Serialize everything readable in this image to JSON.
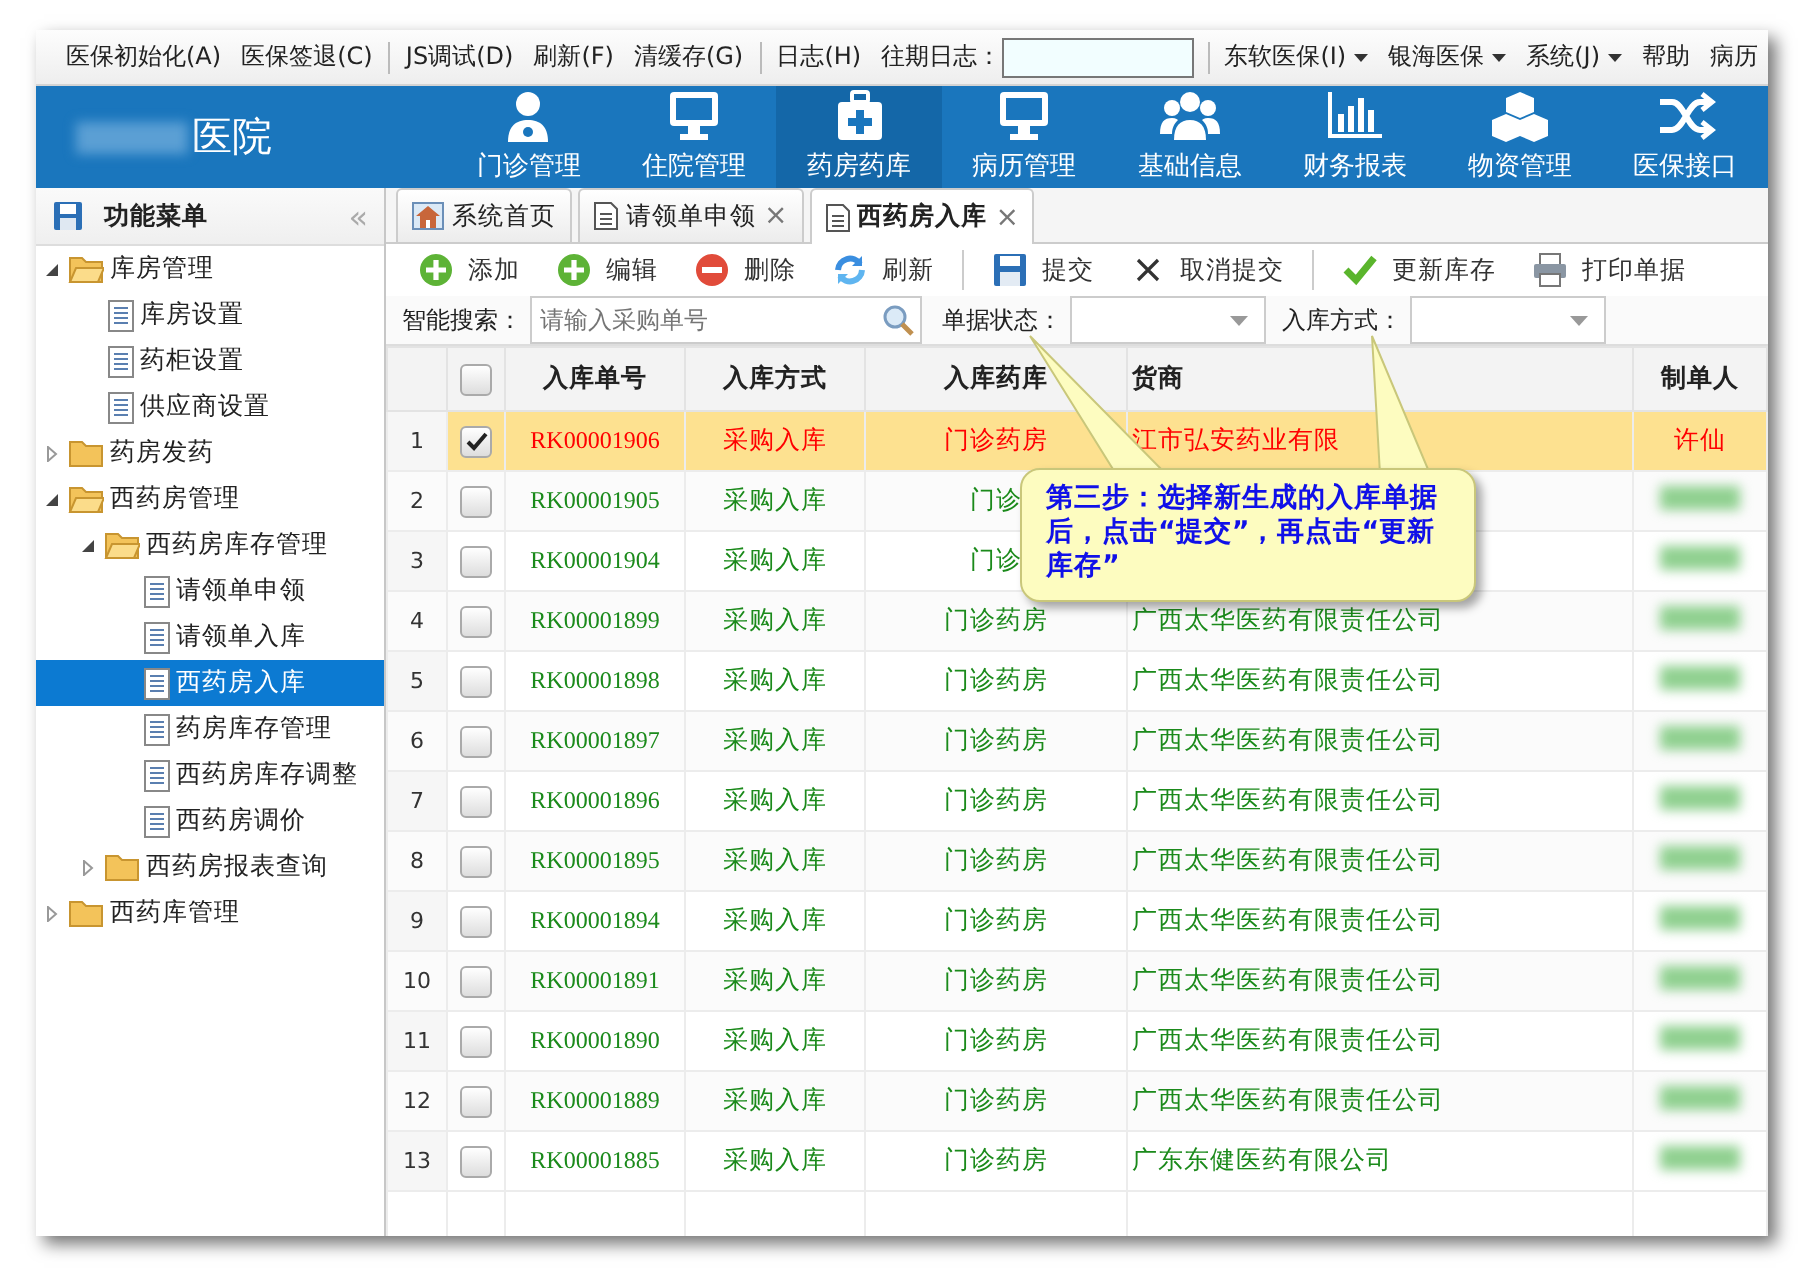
{
  "menu_bar": [
    {
      "kind": "item",
      "label": "医保初始化(A)",
      "has_menu": false
    },
    {
      "kind": "item",
      "label": "医保签退(C)",
      "has_menu": false
    },
    {
      "kind": "separator"
    },
    {
      "kind": "item",
      "label": "JS调试(D)",
      "has_menu": false
    },
    {
      "kind": "item",
      "label": "刷新(F)",
      "has_menu": false
    },
    {
      "kind": "item",
      "label": "清缓存(G)",
      "has_menu": false
    },
    {
      "kind": "separator"
    },
    {
      "kind": "item",
      "label": "日志(H)",
      "has_menu": false
    },
    {
      "kind": "field",
      "label": "往期日志："
    },
    {
      "kind": "separator"
    },
    {
      "kind": "item",
      "label": "东软医保(I)",
      "has_menu": true
    },
    {
      "kind": "item",
      "label": "银海医保",
      "has_menu": true
    },
    {
      "kind": "item",
      "label": "系统(J)",
      "has_menu": true
    },
    {
      "kind": "item",
      "label": "帮助",
      "has_menu": false
    },
    {
      "kind": "item",
      "label": "病历",
      "has_menu": false
    }
  ],
  "header": {
    "hospital": "医院",
    "nav": [
      {
        "label": "门诊管理",
        "selected": false
      },
      {
        "label": "住院管理",
        "selected": false
      },
      {
        "label": "药房药库",
        "selected": true
      },
      {
        "label": "病历管理",
        "selected": false
      },
      {
        "label": "基础信息",
        "selected": false
      },
      {
        "label": "财务报表",
        "selected": false
      },
      {
        "label": "物资管理",
        "selected": false
      },
      {
        "label": "医保接口",
        "selected": false
      }
    ]
  },
  "sidebar": {
    "title": "功能菜单",
    "collapse": "«",
    "tree": [
      {
        "kind": "folder",
        "label": "库房管理",
        "expanded": true,
        "children": [
          {
            "kind": "page",
            "label": "库房设置",
            "selected": false
          },
          {
            "kind": "page",
            "label": "药柜设置",
            "selected": false
          },
          {
            "kind": "page",
            "label": "供应商设置",
            "selected": false
          }
        ]
      },
      {
        "kind": "folder",
        "label": "药房发药",
        "expanded": false
      },
      {
        "kind": "folder",
        "label": "西药房管理",
        "expanded": true,
        "children": [
          {
            "kind": "folder",
            "label": "西药房库存管理",
            "expanded": true,
            "children": [
              {
                "kind": "page",
                "label": "请领单申领",
                "selected": false
              },
              {
                "kind": "page",
                "label": "请领单入库",
                "selected": false
              },
              {
                "kind": "page",
                "label": "西药房入库",
                "selected": true
              },
              {
                "kind": "page",
                "label": "药房库存管理",
                "selected": false
              },
              {
                "kind": "page",
                "label": "西药房库存调整",
                "selected": false
              },
              {
                "kind": "page",
                "label": "西药房调价",
                "selected": false
              }
            ]
          },
          {
            "kind": "folder",
            "label": "西药房报表查询",
            "expanded": false
          }
        ]
      },
      {
        "kind": "folder",
        "label": "西药库管理",
        "expanded": false
      }
    ]
  },
  "tabs": [
    {
      "label": "系统首页",
      "selected": false
    },
    {
      "label": "请领单申领",
      "close": "×",
      "selected": false
    },
    {
      "label": "西药房入库",
      "close": "×",
      "selected": true
    }
  ],
  "toolbar": [
    {
      "kind": "button",
      "label": "添加"
    },
    {
      "kind": "button",
      "label": "编辑"
    },
    {
      "kind": "button",
      "label": "删除"
    },
    {
      "kind": "button",
      "label": "刷新"
    },
    {
      "kind": "separator"
    },
    {
      "kind": "button",
      "label": "提交"
    },
    {
      "kind": "button",
      "label": "取消提交"
    },
    {
      "kind": "separator"
    },
    {
      "kind": "button",
      "label": "更新库存"
    },
    {
      "kind": "button",
      "label": "打印单据"
    }
  ],
  "filters": {
    "search": {
      "label": "智能搜索：",
      "placeholder": "请输入采购单号"
    },
    "status": {
      "label": "单据状态："
    },
    "method": {
      "label": "入库方式："
    }
  },
  "table": {
    "select_all_checked": false,
    "columns": [
      "入库单号",
      "入库方式",
      "入库药库",
      "货商",
      "制单人"
    ],
    "rows": [
      {
        "number": "1",
        "checked": true,
        "selected": true,
        "cells": [
          "RK00001906",
          "采购入库",
          "门诊药房",
          "江市弘安药业有限",
          "许仙"
        ]
      },
      {
        "number": "2",
        "checked": false,
        "selected": false,
        "cells": [
          "RK00001905",
          "采购入库",
          "门诊",
          "",
          ""
        ]
      },
      {
        "number": "3",
        "checked": false,
        "selected": false,
        "cells": [
          "RK00001904",
          "采购入库",
          "门诊",
          "",
          ""
        ]
      },
      {
        "number": "4",
        "checked": false,
        "selected": false,
        "cells": [
          "RK00001899",
          "采购入库",
          "门诊药房",
          "广西太华医药有限责任公司",
          ""
        ]
      },
      {
        "number": "5",
        "checked": false,
        "selected": false,
        "cells": [
          "RK00001898",
          "采购入库",
          "门诊药房",
          "广西太华医药有限责任公司",
          ""
        ]
      },
      {
        "number": "6",
        "checked": false,
        "selected": false,
        "cells": [
          "RK00001897",
          "采购入库",
          "门诊药房",
          "广西太华医药有限责任公司",
          ""
        ]
      },
      {
        "number": "7",
        "checked": false,
        "selected": false,
        "cells": [
          "RK00001896",
          "采购入库",
          "门诊药房",
          "广西太华医药有限责任公司",
          ""
        ]
      },
      {
        "number": "8",
        "checked": false,
        "selected": false,
        "cells": [
          "RK00001895",
          "采购入库",
          "门诊药房",
          "广西太华医药有限责任公司",
          ""
        ]
      },
      {
        "number": "9",
        "checked": false,
        "selected": false,
        "cells": [
          "RK00001894",
          "采购入库",
          "门诊药房",
          "广西太华医药有限责任公司",
          ""
        ]
      },
      {
        "number": "10",
        "checked": false,
        "selected": false,
        "cells": [
          "RK00001891",
          "采购入库",
          "门诊药房",
          "广西太华医药有限责任公司",
          ""
        ]
      },
      {
        "number": "11",
        "checked": false,
        "selected": false,
        "cells": [
          "RK00001890",
          "采购入库",
          "门诊药房",
          "广西太华医药有限责任公司",
          ""
        ]
      },
      {
        "number": "12",
        "checked": false,
        "selected": false,
        "cells": [
          "RK00001889",
          "采购入库",
          "门诊药房",
          "广西太华医药有限责任公司",
          ""
        ]
      },
      {
        "number": "13",
        "checked": false,
        "selected": false,
        "cells": [
          "RK00001885",
          "采购入库",
          "门诊药房",
          "广东东健医药有限公司",
          ""
        ]
      }
    ]
  },
  "callout": {
    "text": "第三步：选择新生成的入库单据后，点击“提交”，再点击“更新库存”"
  }
}
